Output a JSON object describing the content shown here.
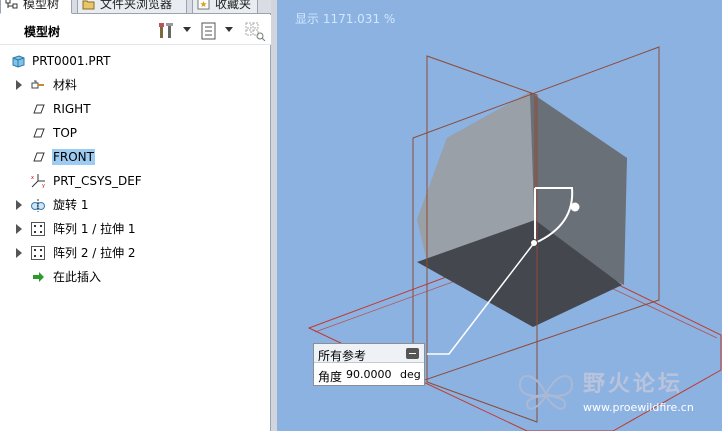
{
  "tabs": [
    {
      "label": "模型树",
      "icon": "model-tree-icon",
      "active": true
    },
    {
      "label": "文件夹浏览器",
      "icon": "folder-browser-icon",
      "active": false
    },
    {
      "label": "收藏夹",
      "icon": "favorites-icon",
      "active": false
    }
  ],
  "toolbar": {
    "title": "模型树",
    "buttons": [
      "settings-tools-icon",
      "show-list-icon",
      "filter-icon"
    ]
  },
  "tree": {
    "root": "PRT0001.PRT",
    "items": [
      {
        "label": "材料",
        "icon": "material-icon",
        "expandable": true
      },
      {
        "label": "RIGHT",
        "icon": "datum-plane-icon",
        "expandable": false
      },
      {
        "label": "TOP",
        "icon": "datum-plane-icon",
        "expandable": false
      },
      {
        "label": "FRONT",
        "icon": "datum-plane-icon",
        "expandable": false,
        "selected": true
      },
      {
        "label": "PRT_CSYS_DEF",
        "icon": "coordinate-system-icon",
        "expandable": false
      },
      {
        "label": "旋转 1",
        "icon": "revolve-icon",
        "expandable": true
      },
      {
        "label": "阵列 1 / 拉伸 1",
        "icon": "pattern-icon",
        "expandable": true
      },
      {
        "label": "阵列 2 / 拉伸 2",
        "icon": "pattern-icon",
        "expandable": true
      },
      {
        "label": "在此插入",
        "icon": "insert-here-arrow-icon",
        "expandable": false
      }
    ]
  },
  "view": {
    "scale_text": "显示 1171.031 %"
  },
  "ref_panel": {
    "title": "所有参考",
    "angle_label": "角度",
    "angle_value": "90.0000",
    "angle_unit": "deg"
  },
  "watermark": {
    "title": "野火论坛",
    "url": "www.proewildfire.cn"
  },
  "colors": {
    "background": "#8cb2e2",
    "cube_top": "#8a9099",
    "cube_left": "#5c6168",
    "cube_right": "#72777f",
    "datum_plane": "#c0392b",
    "selection": "#9ecbf2"
  }
}
